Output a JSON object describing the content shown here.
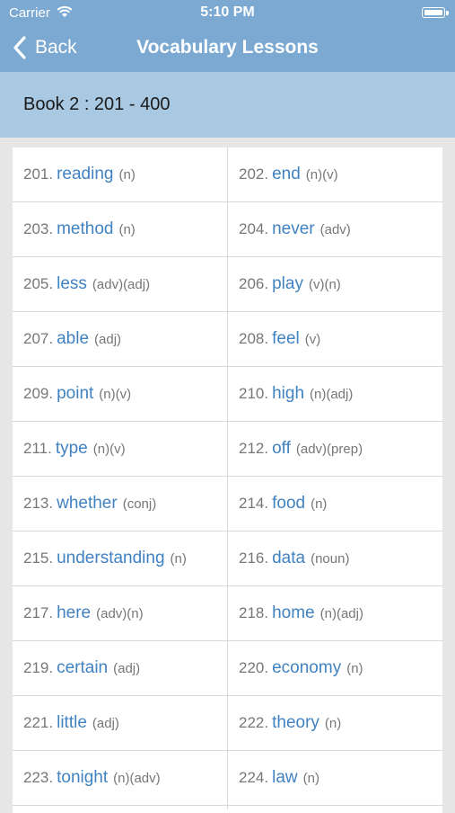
{
  "status_bar": {
    "carrier": "Carrier",
    "time": "5:10 PM"
  },
  "nav": {
    "back_label": "Back",
    "title": "Vocabulary Lessons"
  },
  "section": {
    "title": "Book 2 : 201 - 400"
  },
  "words": [
    {
      "num": "201.",
      "word": "reading",
      "pos": "(n)"
    },
    {
      "num": "202.",
      "word": "end",
      "pos": "(n)(v)"
    },
    {
      "num": "203.",
      "word": "method",
      "pos": "(n)"
    },
    {
      "num": "204.",
      "word": "never",
      "pos": "(adv)"
    },
    {
      "num": "205.",
      "word": "less",
      "pos": "(adv)(adj)"
    },
    {
      "num": "206.",
      "word": "play",
      "pos": "(v)(n)"
    },
    {
      "num": "207.",
      "word": "able",
      "pos": "(adj)"
    },
    {
      "num": "208.",
      "word": "feel",
      "pos": "(v)"
    },
    {
      "num": "209.",
      "word": "point",
      "pos": "(n)(v)"
    },
    {
      "num": "210.",
      "word": "high",
      "pos": "(n)(adj)"
    },
    {
      "num": "211.",
      "word": "type",
      "pos": "(n)(v)"
    },
    {
      "num": "212.",
      "word": "off",
      "pos": "(adv)(prep)"
    },
    {
      "num": "213.",
      "word": "whether",
      "pos": "(conj)"
    },
    {
      "num": "214.",
      "word": "food",
      "pos": "(n)"
    },
    {
      "num": "215.",
      "word": "understanding",
      "pos": "(n)"
    },
    {
      "num": "216.",
      "word": "data",
      "pos": "(noun)"
    },
    {
      "num": "217.",
      "word": "here",
      "pos": "(adv)(n)"
    },
    {
      "num": "218.",
      "word": "home",
      "pos": "(n)(adj)"
    },
    {
      "num": "219.",
      "word": "certain",
      "pos": "(adj)"
    },
    {
      "num": "220.",
      "word": "economy",
      "pos": "(n)"
    },
    {
      "num": "221.",
      "word": "little",
      "pos": "(adj)"
    },
    {
      "num": "222.",
      "word": "theory",
      "pos": "(n)"
    },
    {
      "num": "223.",
      "word": "tonight",
      "pos": "(n)(adv)"
    },
    {
      "num": "224.",
      "word": "law",
      "pos": "(n)"
    }
  ]
}
